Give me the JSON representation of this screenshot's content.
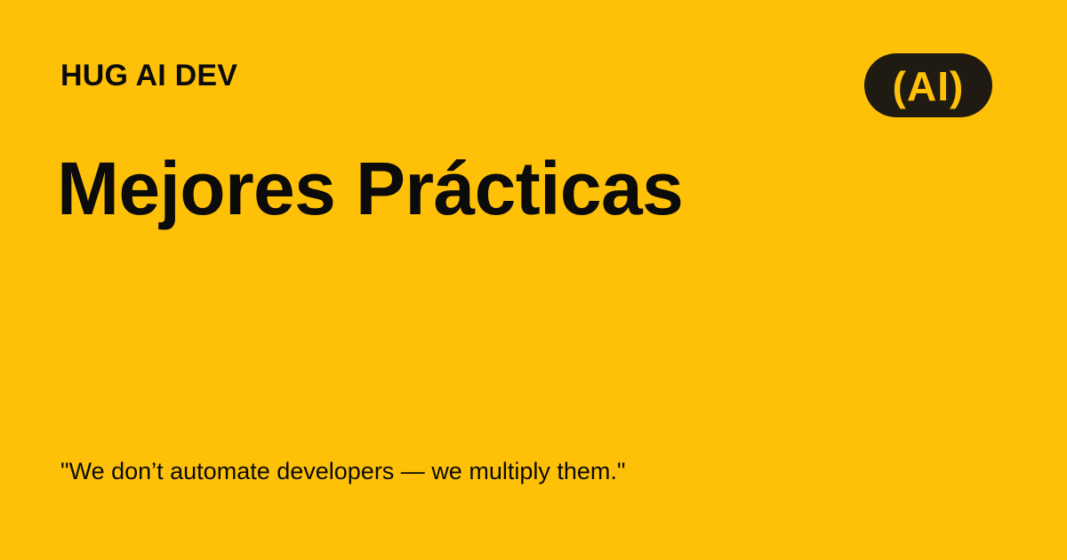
{
  "header": {
    "brand": "HUG AI DEV",
    "logo_text": "(AI)"
  },
  "main": {
    "title": "Mejores Prácticas"
  },
  "footer": {
    "quote": "\"We don’t automate developers — we multiply them.\""
  },
  "colors": {
    "background": "#FFC107",
    "text": "#0B0B0B",
    "logo_background": "#1F1B12",
    "logo_text": "#FFC107"
  }
}
